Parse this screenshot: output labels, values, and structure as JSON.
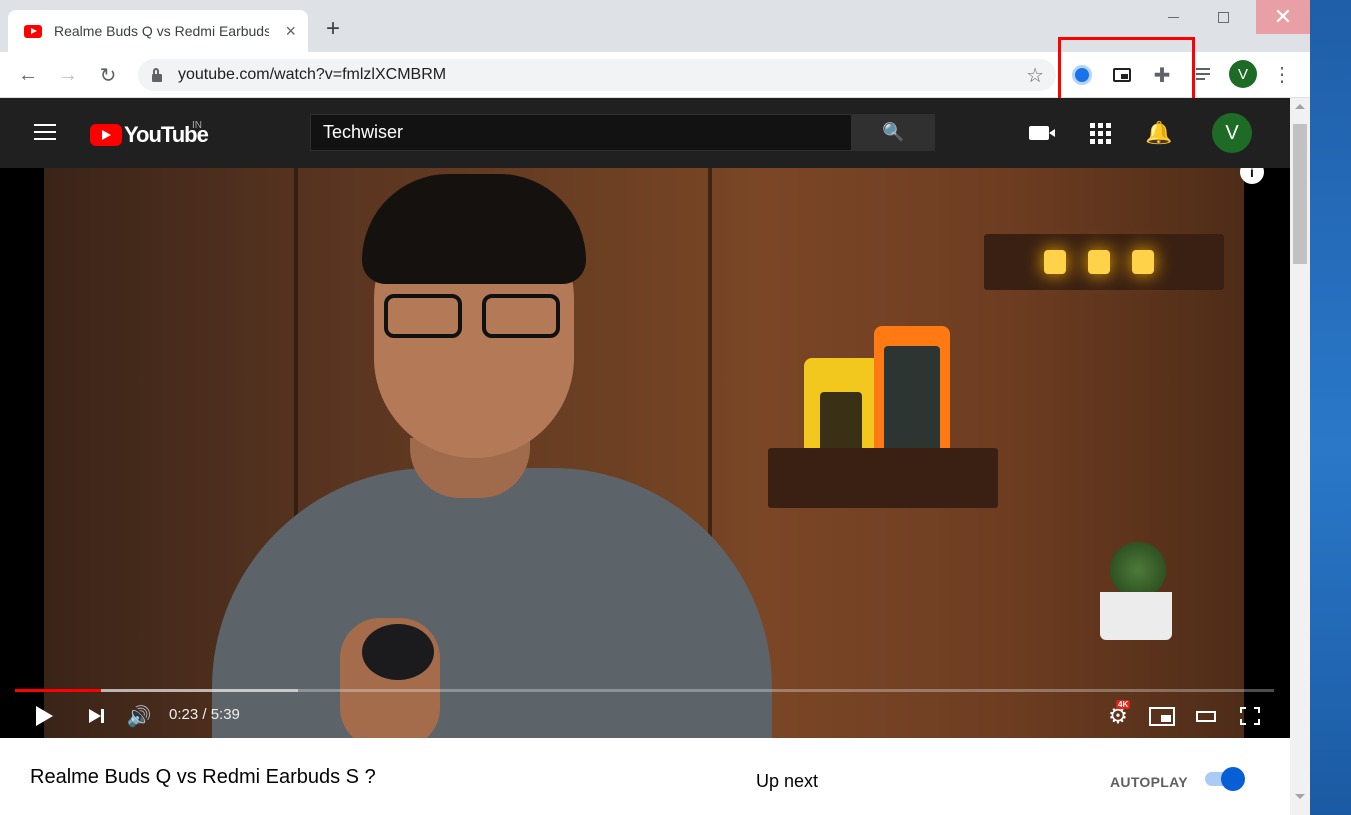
{
  "browser": {
    "tab": {
      "title": "Realme Buds Q vs Redmi Earbuds S ?",
      "close_icon": "×"
    },
    "new_tab_icon": "+",
    "address": {
      "url": "youtube.com/watch?v=fmlzlXCMBRM"
    },
    "profile_initial": "V",
    "icons": {
      "back": "←",
      "forward": "→",
      "reload": "↻",
      "star": "☆",
      "puzzle": "✚",
      "kebab": "⋮",
      "close": "✕"
    },
    "highlight_color": "#ff0000"
  },
  "youtube": {
    "logo_text": "YouTube",
    "country_code": "IN",
    "search": {
      "value": "Techwiser",
      "icon": "🔍"
    },
    "bell_icon": "🔔",
    "avatar_initial": "V",
    "player": {
      "time": "0:23 / 5:39",
      "progress_played": 0.068,
      "progress_buffered": 0.225,
      "quality_badge": "4K",
      "info_icon": "i",
      "volume_icon": "🔊",
      "settings_icon": "⚙"
    },
    "video_title": "Realme Buds Q vs Redmi Earbuds S ?",
    "up_next": "Up next",
    "autoplay_label": "AUTOPLAY",
    "autoplay_on": true
  },
  "colors": {
    "youtube_red": "#ff0000",
    "dark_bg": "#202020",
    "toggle_blue": "#065fd4"
  }
}
